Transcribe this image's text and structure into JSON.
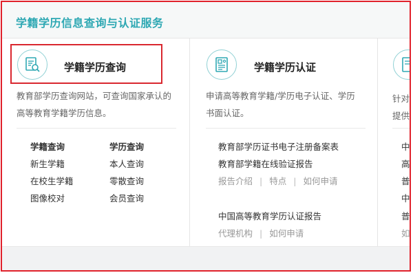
{
  "header": {
    "title": "学籍学历信息查询与认证服务"
  },
  "card1": {
    "title": "学籍学历查询",
    "desc_line1": "教育部学历查询网站，可查询国家承认的",
    "desc_line2": "高等教育学籍学历信息。",
    "col_a": {
      "head": "学籍查询",
      "items": [
        "新生学籍",
        "在校生学籍",
        "图像校对"
      ]
    },
    "col_b": {
      "head": "学历查询",
      "items": [
        "本人查询",
        "零散查询",
        "会员查询"
      ]
    }
  },
  "card2": {
    "title": "学籍学历认证",
    "desc_line1": "申请高等教育学籍/学历电子认证、学历",
    "desc_line2": "书面认证。",
    "link1": "教育部学历证书电子注册备案表",
    "link2": "教育部学籍在线验证报告",
    "sub1": [
      "报告介绍",
      "特点",
      "如何申请"
    ],
    "link3": "中国高等教育学历认证报告",
    "sub2": [
      "代理机构",
      "如何申请"
    ]
  },
  "card3": {
    "desc_line1": "针对境",
    "desc_line2": "提供的",
    "items": [
      "中等",
      "高等",
      "普通",
      "中等",
      "普通",
      "如何"
    ]
  },
  "colors": {
    "accent": "#2ea8b3",
    "highlight": "#d9262e"
  }
}
